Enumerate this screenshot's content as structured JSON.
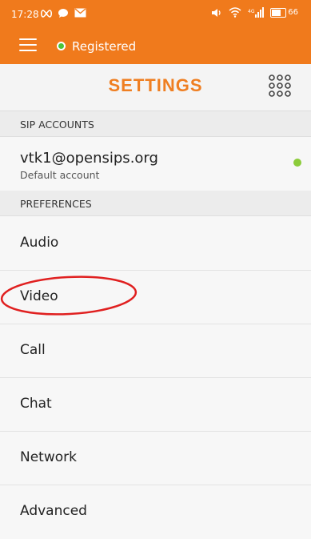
{
  "status_bar": {
    "time": "17:28",
    "battery": "66",
    "icons": [
      "infinity-icon",
      "chat-bubble-icon",
      "mail-icon",
      "volume-icon",
      "wifi-icon",
      "signal-icon",
      "battery-icon"
    ]
  },
  "app_bar": {
    "status_text": "Registered",
    "status_color": "#4bc53a",
    "accent_color": "#f07a1c"
  },
  "header": {
    "title": "SETTINGS"
  },
  "sections": {
    "sip_accounts": "SIP ACCOUNTS",
    "preferences": "PREFERENCES"
  },
  "account": {
    "name": "vtk1@opensips.org",
    "subtitle": "Default account",
    "status_color": "#8ccc3a"
  },
  "preferences": [
    {
      "label": "Audio"
    },
    {
      "label": "Video"
    },
    {
      "label": "Call"
    },
    {
      "label": "Chat"
    },
    {
      "label": "Network"
    },
    {
      "label": "Advanced"
    }
  ],
  "annotation": {
    "circled_item": "Video",
    "color": "#e02020"
  }
}
